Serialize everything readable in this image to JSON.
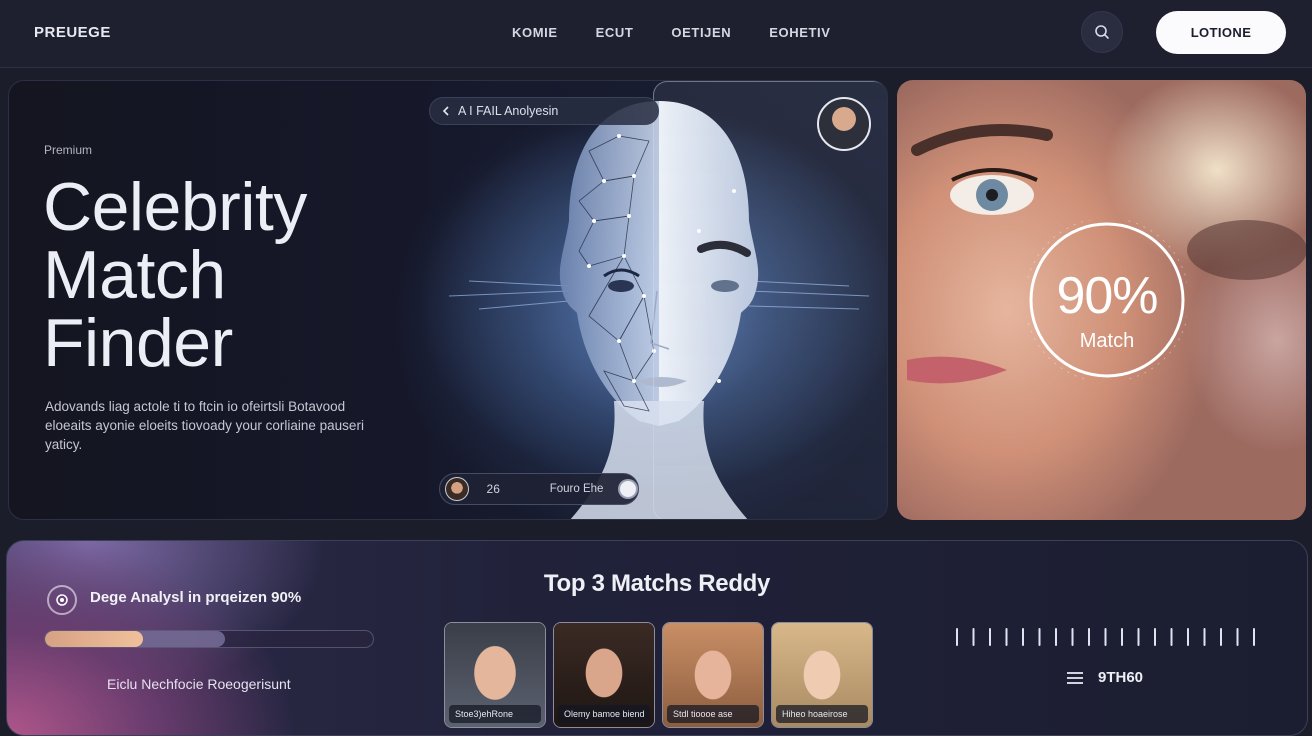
{
  "brand": "PREUEGE",
  "nav": {
    "items": [
      "KOMIE",
      "ECUT",
      "OETIJEN",
      "EOHETIV"
    ]
  },
  "header": {
    "cta_label": "LOTIONE"
  },
  "hero": {
    "eyebrow": "Premium",
    "title_lines": [
      "Celebrity",
      "Match",
      "Finder"
    ],
    "description": "Adovands liag actole ti to ftcin io ofeirtsli Botavood eloeaits ayonie eloeits tiovoady your corliaine pauseri yaticy.",
    "analysis_pill": "A I FAIL Anolyesin",
    "bottom_pill": {
      "count": "26",
      "label": "Fouro Ehe"
    }
  },
  "match": {
    "percent": "90%",
    "label": "Match"
  },
  "status": {
    "text": "Dege Analysl in prqeizen 90%",
    "progress": 0.3,
    "footer": "Eiclu Nechfocie Roeogerisunt"
  },
  "matches": {
    "title": "Top 3 Matchs Reddy",
    "cards": [
      {
        "caption": "Stoe3)ehRone"
      },
      {
        "caption": "Olemy bamoe biend"
      },
      {
        "caption": "Stdl tioooe ase"
      },
      {
        "caption": "Hiheo hoaeirose"
      }
    ]
  },
  "counter": "9TH60",
  "colors": {
    "accent": "#f0c09b",
    "cta_bg": "#fbfbfd",
    "background": "#1b1d2b"
  },
  "icons": [
    "search-icon",
    "chevron-left-icon",
    "list-icon",
    "waveform-icon",
    "scan-icon"
  ]
}
